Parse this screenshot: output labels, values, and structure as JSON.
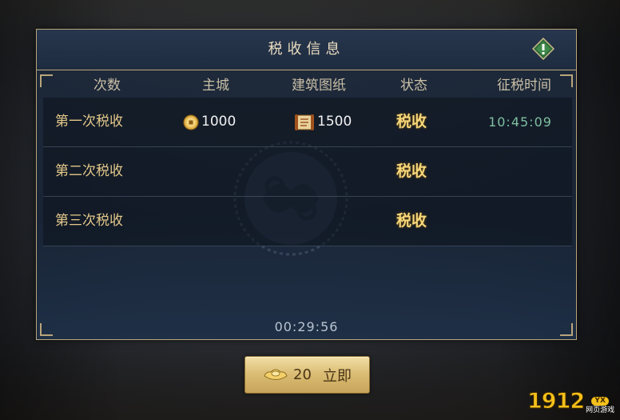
{
  "dialog": {
    "title": "税收信息"
  },
  "table": {
    "headers": [
      "次数",
      "主城",
      "建筑图纸",
      "状态",
      "征税时间"
    ],
    "rows": [
      {
        "name": "第一次税收",
        "city_amount": "1000",
        "drawing_amount": "1500",
        "status": "税收",
        "time": "10:45:09"
      },
      {
        "name": "第二次税收",
        "city_amount": "",
        "drawing_amount": "",
        "status": "税收",
        "time": ""
      },
      {
        "name": "第三次税收",
        "city_amount": "",
        "drawing_amount": "",
        "status": "税收",
        "time": ""
      }
    ]
  },
  "countdown": "00:29:56",
  "buy_button": {
    "price": "20",
    "label": "立即",
    "icon": "gold-ingot-icon"
  },
  "watermark": {
    "number": "1912",
    "badge": "YX",
    "subtitle": "网页游戏"
  },
  "colors": {
    "gold_text": "#e3c88a",
    "status_text": "#f6d77a",
    "time_text": "#7fbfa0",
    "panel_border": "#b9a57a"
  }
}
